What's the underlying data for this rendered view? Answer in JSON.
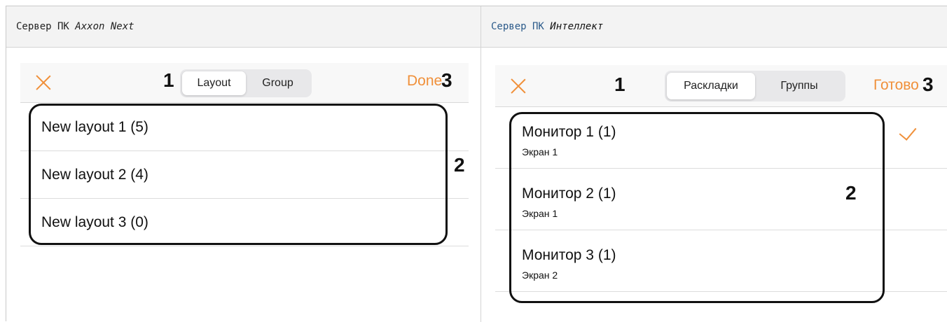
{
  "columns": [
    {
      "prefix": "Сервер ПК ",
      "product": "Axxon Next"
    },
    {
      "prefix": "Сервер ПК ",
      "product": "Интеллект"
    }
  ],
  "axxon": {
    "tabs": [
      "Layout",
      "Group"
    ],
    "done_label": "Done",
    "items": [
      "New layout 1 (5)",
      "New layout 2 (4)",
      "New layout 3 (0)"
    ]
  },
  "intellect": {
    "tabs": [
      "Раскладки",
      "Группы"
    ],
    "done_label": "Готово",
    "items": [
      {
        "title": "Монитор 1 (1)",
        "subtitle": "Экран 1",
        "selected": true
      },
      {
        "title": "Монитор 2 (1)",
        "subtitle": "Экран 1",
        "selected": false
      },
      {
        "title": "Монитор 3 (1)",
        "subtitle": "Экран 2",
        "selected": false
      }
    ]
  },
  "callouts": {
    "segment": "1",
    "list": "2",
    "done": "3"
  },
  "colors": {
    "accent": "#f0903a",
    "header_bg": "#f3f3f3",
    "link_text": "#2b5a8a"
  },
  "icons": {
    "close": "close-icon",
    "check": "checkmark-icon"
  }
}
